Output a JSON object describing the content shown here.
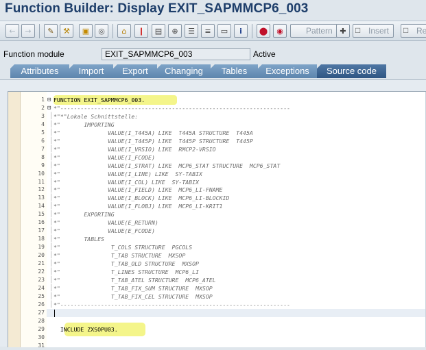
{
  "window": {
    "title": "Function Builder: Display EXIT_SAPMMCP6_003"
  },
  "toolbar": {
    "pattern_label": "Pattern",
    "insert_label": "Insert",
    "replace_label": "Re",
    "icons": [
      "back-icon",
      "forward-icon",
      "change-toggle-icon",
      "activate-icon",
      "other-object-icon",
      "where-used-icon",
      "display-object-list-icon",
      "enhancement-icon",
      "navigation-window-icon",
      "hierarchy-icon",
      "help-doc-icon",
      "info-icon",
      "breakpoint-icon",
      "external-breakpoint-icon",
      "pattern-icon",
      "insert-icon",
      "replace-icon"
    ]
  },
  "header": {
    "field_label": "Function module",
    "field_value": "EXIT_SAPMMCP6_003",
    "status": "Active"
  },
  "tabs": [
    {
      "label": "Attributes"
    },
    {
      "label": "Import"
    },
    {
      "label": "Export"
    },
    {
      "label": "Changing"
    },
    {
      "label": "Tables"
    },
    {
      "label": "Exceptions"
    },
    {
      "label": "Source code"
    }
  ],
  "source": {
    "lines": [
      {
        "n": "1",
        "text": "FUNCTION EXIT_SAPMMCP6_003.",
        "kw": true
      },
      {
        "n": "2",
        "text": "*\"--------------------------------------------------------------------",
        "kw": false
      },
      {
        "n": "3",
        "text": "*\"*\"Lokale Schnittstelle:",
        "kw": false
      },
      {
        "n": "4",
        "text": "*\"       IMPORTING",
        "kw": false
      },
      {
        "n": "5",
        "text": "*\"              VALUE(I_T445A) LIKE  T445A STRUCTURE  T445A",
        "kw": false
      },
      {
        "n": "6",
        "text": "*\"              VALUE(I_T445P) LIKE  T445P STRUCTURE  T445P",
        "kw": false
      },
      {
        "n": "7",
        "text": "*\"              VALUE(I_VRSIO) LIKE  RMCP2-VRSIO",
        "kw": false
      },
      {
        "n": "8",
        "text": "*\"              VALUE(I_FCODE)",
        "kw": false
      },
      {
        "n": "9",
        "text": "*\"              VALUE(I_STRAT) LIKE  MCP6_STAT STRUCTURE  MCP6_STAT",
        "kw": false
      },
      {
        "n": "10",
        "text": "*\"              VALUE(I_LINE) LIKE  SY-TABIX",
        "kw": false
      },
      {
        "n": "11",
        "text": "*\"              VALUE(I_COL) LIKE  SY-TABIX",
        "kw": false
      },
      {
        "n": "12",
        "text": "*\"              VALUE(I_FIELD) LIKE  MCP6_LI-FNAME",
        "kw": false
      },
      {
        "n": "13",
        "text": "*\"              VALUE(I_BLOCK) LIKE  MCP6_LI-BLOCKID",
        "kw": false
      },
      {
        "n": "14",
        "text": "*\"              VALUE(I_FLOBJ) LIKE  MCP6_LI-KRIT1",
        "kw": false
      },
      {
        "n": "15",
        "text": "*\"       EXPORTING",
        "kw": false
      },
      {
        "n": "16",
        "text": "*\"              VALUE(E_RETURN)",
        "kw": false
      },
      {
        "n": "17",
        "text": "*\"              VALUE(E_FCODE)",
        "kw": false
      },
      {
        "n": "18",
        "text": "*\"       TABLES",
        "kw": false
      },
      {
        "n": "19",
        "text": "*\"               T_COLS STRUCTURE  PGCOLS",
        "kw": false
      },
      {
        "n": "20",
        "text": "*\"               T_TAB STRUCTURE  MXSOP",
        "kw": false
      },
      {
        "n": "21",
        "text": "*\"               T_TAB_OLD STRUCTURE  MXSOP",
        "kw": false
      },
      {
        "n": "22",
        "text": "*\"               T_LINES STRUCTURE  MCP6_LI",
        "kw": false
      },
      {
        "n": "23",
        "text": "*\"               T_TAB_ATEL STRUCTURE  MCP6_ATEL",
        "kw": false
      },
      {
        "n": "24",
        "text": "*\"               T_TAB_FIX_SUM STRUCTURE  MXSOP",
        "kw": false
      },
      {
        "n": "25",
        "text": "*\"               T_TAB_FIX_CEL STRUCTURE  MXSOP",
        "kw": false
      },
      {
        "n": "26",
        "text": "*\"--------------------------------------------------------------------",
        "kw": false
      },
      {
        "n": "27",
        "text": "",
        "kw": true
      },
      {
        "n": "28",
        "text": "",
        "kw": true
      },
      {
        "n": "29",
        "text": "  INCLUDE ZXSOPU03.",
        "kw": true
      },
      {
        "n": "30",
        "text": "",
        "kw": true
      },
      {
        "n": "31",
        "text": "",
        "kw": true
      }
    ]
  },
  "colors": {
    "title": "#1f3f6b",
    "tab": "#6a91b9",
    "tab_active": "#3d6593",
    "highlight": "#f4f58a"
  }
}
